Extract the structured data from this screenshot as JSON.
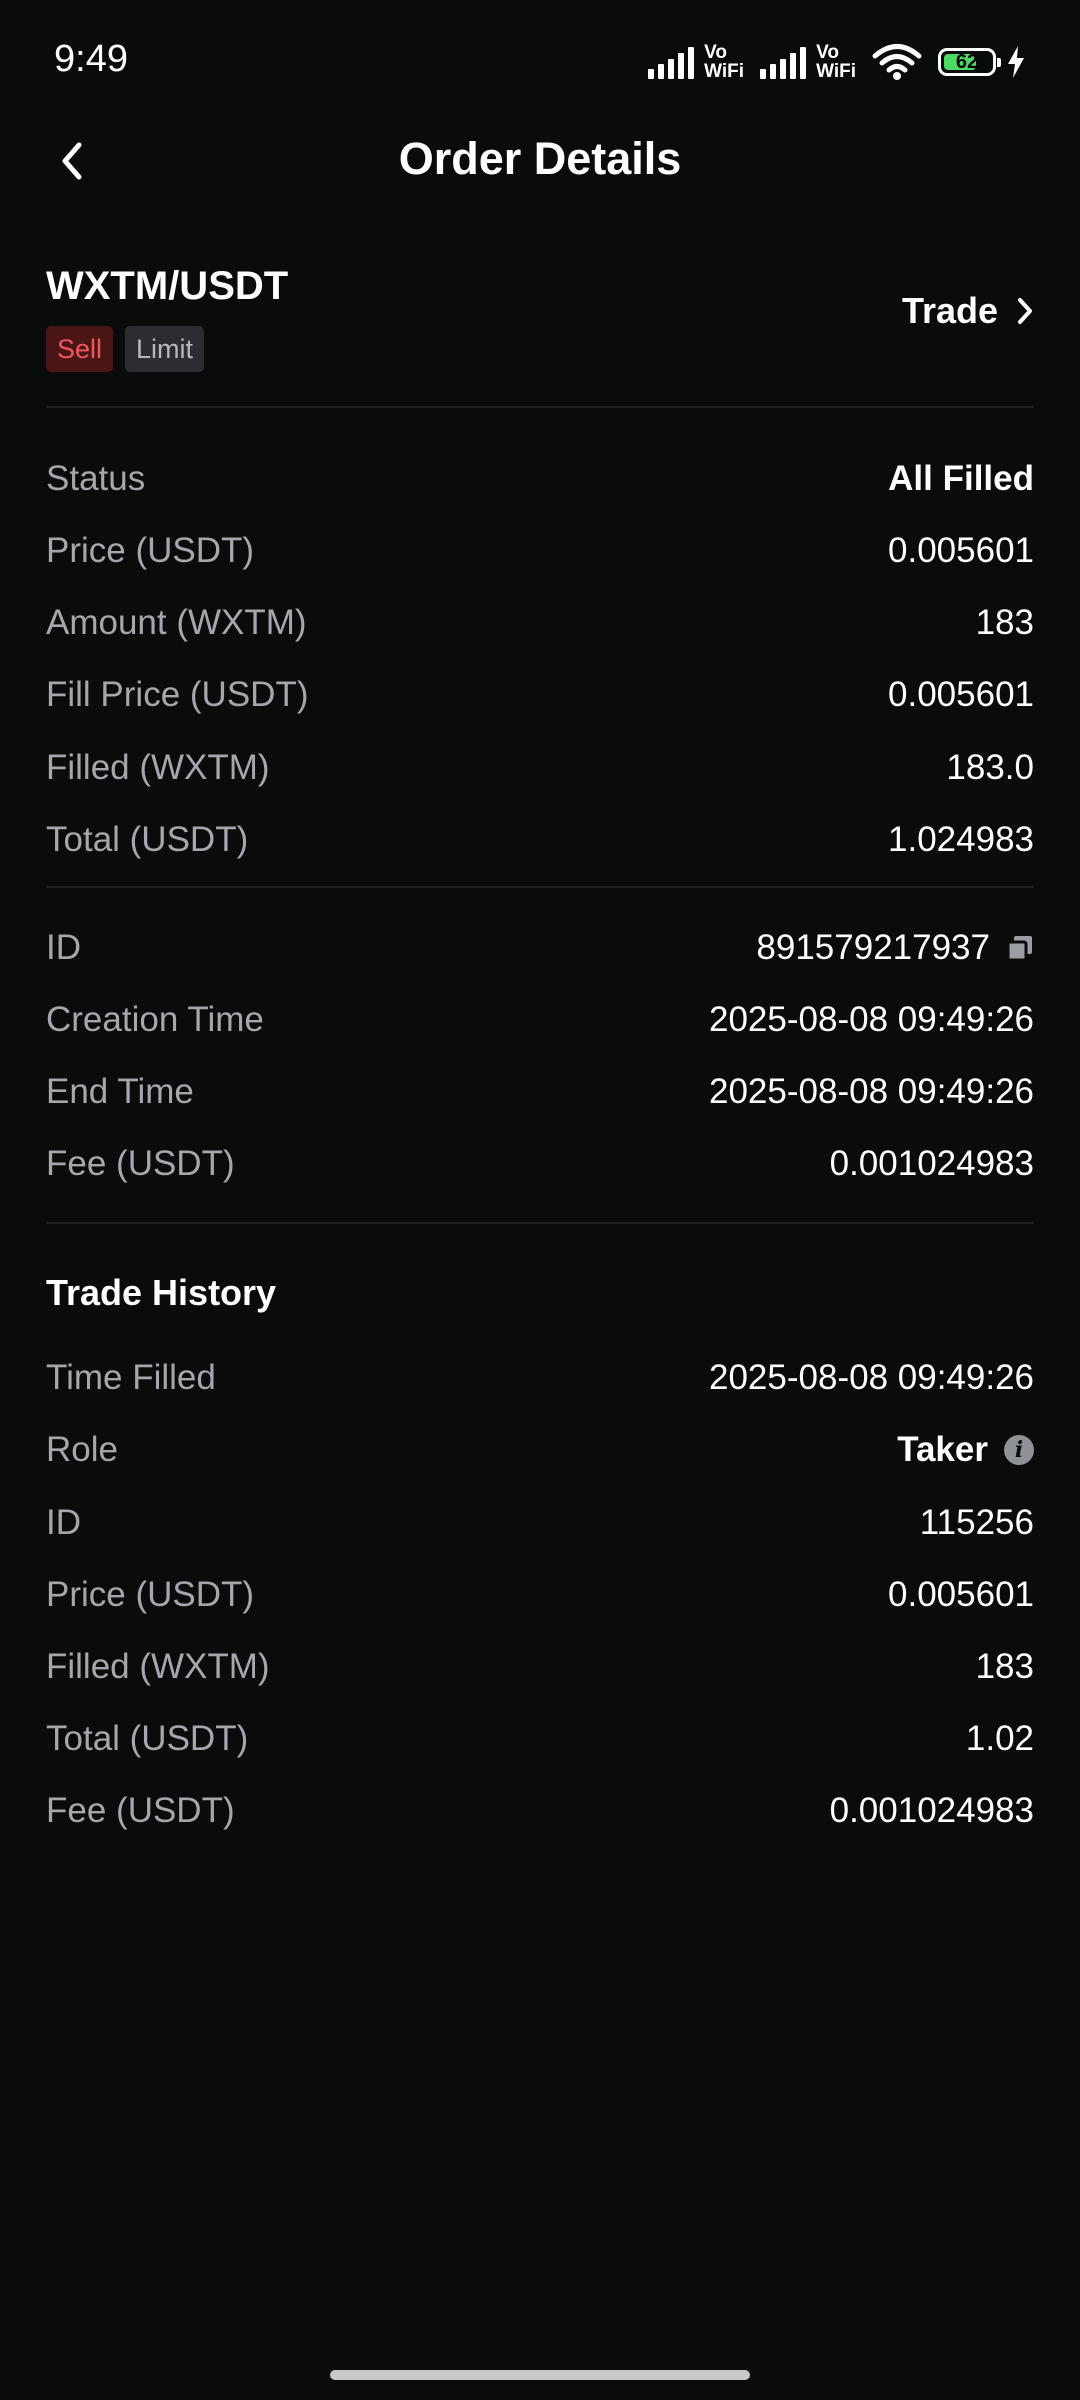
{
  "status_bar": {
    "time": "9:49",
    "vowifi_top": "Vo",
    "vowifi_bottom": "WiFi",
    "battery": "62"
  },
  "header": {
    "title": "Order Details",
    "back_icon": "chevron-left-icon"
  },
  "pair": {
    "symbol": "WXTM/USDT",
    "side_tag": "Sell",
    "type_tag": "Limit",
    "trade_label": "Trade",
    "colors": {
      "sell_text": "#f0575a",
      "sell_bg": "#4a1515"
    }
  },
  "order": {
    "status_label": "Status",
    "status_value": "All Filled",
    "price_label": "Price (USDT)",
    "price_value": "0.005601",
    "amount_label": "Amount (WXTM)",
    "amount_value": "183",
    "fill_price_label": "Fill Price (USDT)",
    "fill_price_value": "0.005601",
    "filled_label": "Filled (WXTM)",
    "filled_value": "183.0",
    "total_label": "Total (USDT)",
    "total_value": "1.024983"
  },
  "order_meta": {
    "id_label": "ID",
    "id_value": "891579217937",
    "creation_label": "Creation Time",
    "creation_value": "2025-08-08 09:49:26",
    "end_label": "End Time",
    "end_value": "2025-08-08 09:49:26",
    "fee_label": "Fee (USDT)",
    "fee_value": "0.001024983"
  },
  "trade_history": {
    "title": "Trade History",
    "time_label": "Time Filled",
    "time_value": "2025-08-08 09:49:26",
    "role_label": "Role",
    "role_value": "Taker",
    "id_label": "ID",
    "id_value": "115256",
    "price_label": "Price (USDT)",
    "price_value": "0.005601",
    "filled_label": "Filled (WXTM)",
    "filled_value": "183",
    "total_label": "Total (USDT)",
    "total_value": "1.02",
    "fee_label": "Fee (USDT)",
    "fee_value": "0.001024983"
  }
}
